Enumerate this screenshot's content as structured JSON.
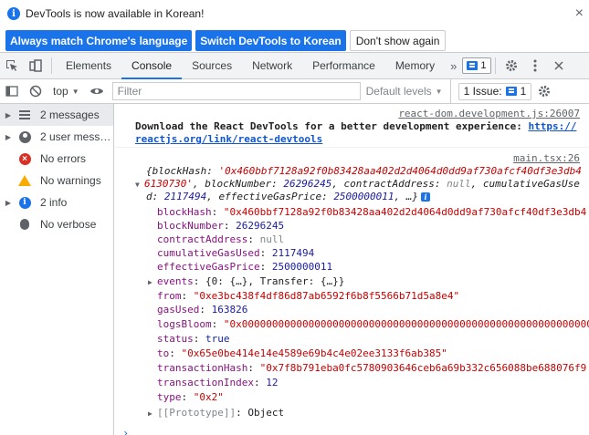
{
  "infobar": {
    "message": "DevTools is now available in Korean!",
    "btn_match": "Always match Chrome's language",
    "btn_switch": "Switch DevTools to Korean",
    "btn_dont_show": "Don't show again",
    "close": "×"
  },
  "tabs": {
    "items": [
      "Elements",
      "Console",
      "Sources",
      "Network",
      "Performance",
      "Memory"
    ],
    "more": "»",
    "issue_count": "1"
  },
  "console_toolbar": {
    "context": "top",
    "filter_placeholder": "Filter",
    "levels": "Default levels",
    "issues_label": "1 Issue:",
    "issues_count": "1"
  },
  "sidebar": {
    "items": [
      {
        "label": "2 messages",
        "icon": "list-icon"
      },
      {
        "label": "2 user mess…",
        "icon": "user-icon"
      },
      {
        "label": "No errors",
        "icon": "error-icon"
      },
      {
        "label": "No warnings",
        "icon": "warning-icon"
      },
      {
        "label": "2 info",
        "icon": "info-icon"
      },
      {
        "label": "No verbose",
        "icon": "bug-icon"
      }
    ]
  },
  "messages": {
    "msg1_source": "react-dom.development.js:26007",
    "msg1_text": "Download the React DevTools for a better development experience:",
    "msg1_link_a": "https://",
    "msg1_link_b": "reactjs.org/link/react-devtools",
    "msg2_source": "main.tsx:26"
  },
  "receipt": {
    "summary_line1_a": "{blockHash: ",
    "summary_line1_b": "'0x460bbf7128a92f0b83428aa402d2d4064d0dd9af730afcf40df3e3db4",
    "summary_line2_a": "6130730'",
    "summary_line2_b": ", blockNumber: ",
    "summary_line2_c": "26296245",
    "summary_line2_d": ", contractAddress: ",
    "summary_line2_e": "null",
    "summary_line2_f": ", cumulativeGasUse",
    "summary_line3_a": "d: ",
    "summary_line3_b": "2117494",
    "summary_line3_c": ", effectiveGasPrice: ",
    "summary_line3_d": "2500000011",
    "summary_line3_e": ", …}",
    "info_badge": "i",
    "fields": {
      "blockHash_k": "blockHash",
      "blockHash_v": "\"0x460bbf7128a92f0b83428aa402d2d4064d0dd9af730afcf40df3e3db4",
      "blockNumber_k": "blockNumber",
      "blockNumber_v": "26296245",
      "contractAddress_k": "contractAddress",
      "contractAddress_v": "null",
      "cumulativeGasUsed_k": "cumulativeGasUsed",
      "cumulativeGasUsed_v": "2117494",
      "effectiveGasPrice_k": "effectiveGasPrice",
      "effectiveGasPrice_v": "2500000011",
      "events_k": "events",
      "events_v": "{0: {…}, Transfer: {…}}",
      "from_k": "from",
      "from_v": "\"0xe3bc438f4df86d87ab6592f6b8f5566b71d5a8e4\"",
      "gasUsed_k": "gasUsed",
      "gasUsed_v": "163826",
      "logsBloom_k": "logsBloom",
      "logsBloom_v": "\"0x000000000000000000000000000000000000000000000000000000000000",
      "status_k": "status",
      "status_v": "true",
      "to_k": "to",
      "to_v": "\"0x65e0be414e14e4589e69b4c4e02ee3133f6ab385\"",
      "transactionHash_k": "transactionHash",
      "transactionHash_v": "\"0x7f8b791eba0fc5780903646ceb6a69b332c656088be688076f9",
      "transactionIndex_k": "transactionIndex",
      "transactionIndex_v": "12",
      "type_k": "type",
      "type_v": "\"0x2\"",
      "prototype_k": "[[Prototype]]",
      "prototype_v": "Object"
    }
  },
  "prompt": "›"
}
